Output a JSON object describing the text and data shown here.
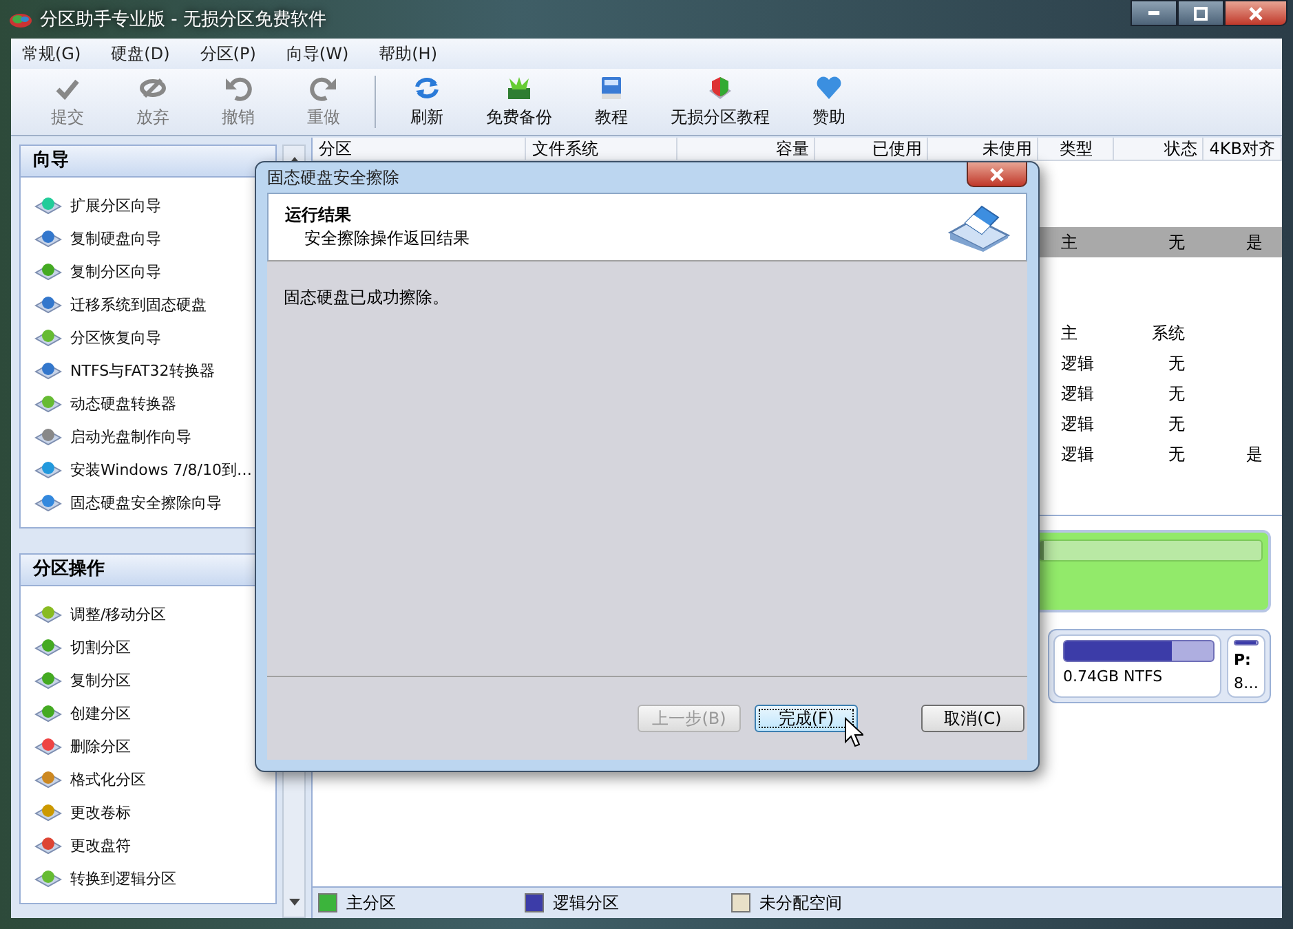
{
  "window": {
    "title": "分区助手专业版 - 无损分区免费软件"
  },
  "menu": [
    "常规(G)",
    "硬盘(D)",
    "分区(P)",
    "向导(W)",
    "帮助(H)"
  ],
  "toolbar": [
    {
      "label": "提交",
      "disabled": true
    },
    {
      "label": "放弃",
      "disabled": true
    },
    {
      "label": "撤销",
      "disabled": true
    },
    {
      "label": "重做",
      "disabled": true
    },
    {
      "label": "刷新",
      "disabled": false
    },
    {
      "label": "免费备份",
      "disabled": false
    },
    {
      "label": "教程",
      "disabled": false
    },
    {
      "label": "无损分区教程",
      "disabled": false
    },
    {
      "label": "赞助",
      "disabled": false
    }
  ],
  "sidebar": [
    {
      "title": "向导",
      "items": [
        "扩展分区向导",
        "复制硬盘向导",
        "复制分区向导",
        "迁移系统到固态硬盘",
        "分区恢复向导",
        "NTFS与FAT32转换器",
        "动态硬盘转换器",
        "启动光盘制作向导",
        "安装Windows 7/8/10到…",
        "固态硬盘安全擦除向导"
      ]
    },
    {
      "title": "分区操作",
      "items": [
        "调整/移动分区",
        "切割分区",
        "复制分区",
        "创建分区",
        "删除分区",
        "格式化分区",
        "更改卷标",
        "更改盘符",
        "转换到逻辑分区"
      ]
    }
  ],
  "table": {
    "columns": [
      "分区",
      "文件系统",
      "容量",
      "已使用",
      "未使用",
      "类型",
      "状态",
      "4KB对齐"
    ],
    "rows": [
      {
        "selected": false
      },
      {
        "selected": false
      },
      {
        "selected": true,
        "type": "主",
        "status": "无",
        "align_4k": "是"
      },
      {
        "selected": false
      },
      {
        "selected": false
      },
      {
        "selected": false,
        "type": "主",
        "status": "系统"
      },
      {
        "selected": false,
        "type": "逻辑",
        "status": "无"
      },
      {
        "selected": false,
        "type": "逻辑",
        "status": "无"
      },
      {
        "selected": false,
        "type": "逻辑",
        "status": "无"
      },
      {
        "selected": false,
        "type": "逻辑",
        "status": "无",
        "align_4k": "是"
      }
    ]
  },
  "disk_map": {
    "disk1": {
      "level": 0.02
    },
    "disk2": {
      "partitions": [
        {
          "detail": "0.74GB NTFS",
          "level": 0.72
        },
        {
          "letter": "P:",
          "detail": "8…",
          "level": 0.95
        }
      ]
    }
  },
  "legend": [
    {
      "label": "主分区",
      "color": "#3cb43c"
    },
    {
      "label": "逻辑分区",
      "color": "#3c3ca8"
    },
    {
      "label": "未分配空间",
      "color": "#e8e0c8"
    }
  ],
  "dialog": {
    "title": "固态硬盘安全擦除",
    "heading": "运行结果",
    "subheading": "安全擦除操作返回结果",
    "message": "固态硬盘已成功擦除。",
    "buttons": [
      {
        "label": "上一步(B)",
        "disabled": true,
        "focused": false
      },
      {
        "label": "完成(F)",
        "disabled": false,
        "focused": true
      },
      {
        "label": "取消(C)",
        "disabled": false,
        "focused": false
      }
    ]
  }
}
